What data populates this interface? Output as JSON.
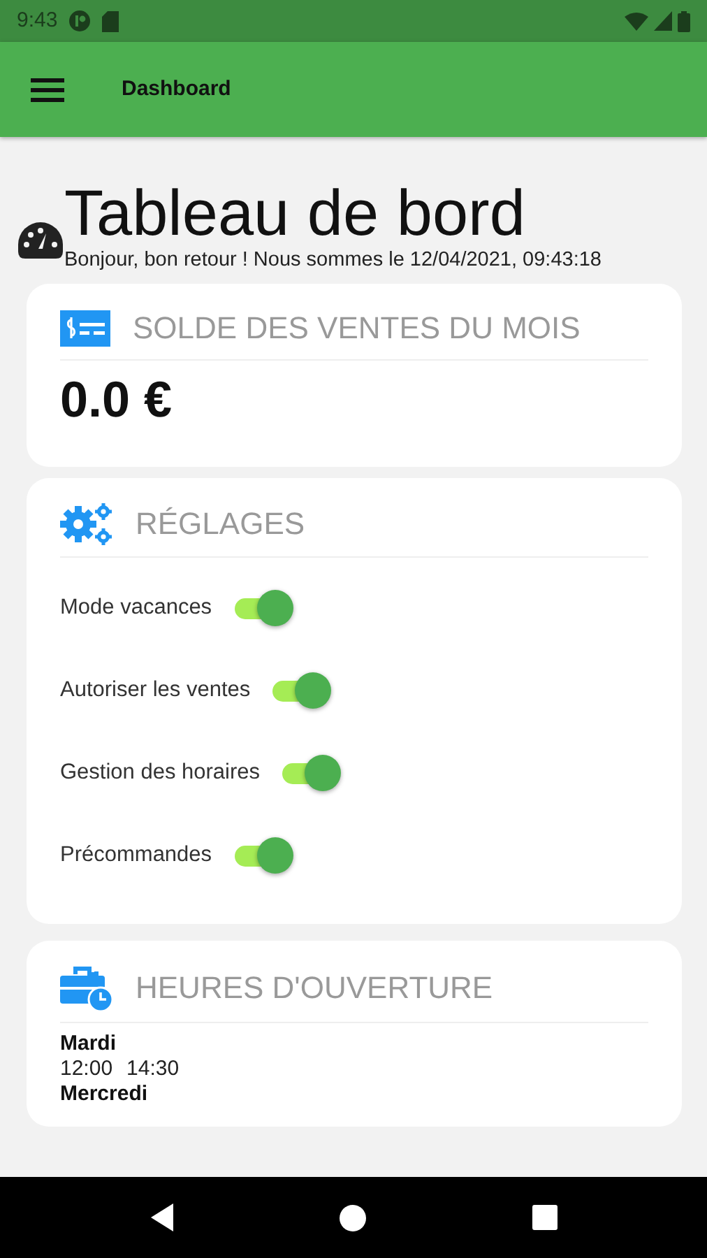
{
  "status_bar": {
    "time": "9:43"
  },
  "app_bar": {
    "title": "Dashboard"
  },
  "header": {
    "title": "Tableau de bord",
    "subtitle": "Bonjour, bon retour ! Nous sommes le 12/04/2021, 09:43:18"
  },
  "sales_card": {
    "title": "SOLDE DES VENTES DU MOIS",
    "amount": "0.0 €"
  },
  "settings_card": {
    "title": "RÉGLAGES",
    "settings": [
      {
        "label": "Mode vacances",
        "on": true
      },
      {
        "label": "Autoriser les ventes",
        "on": true
      },
      {
        "label": "Gestion des horaires",
        "on": true
      },
      {
        "label": "Précommandes",
        "on": true
      }
    ]
  },
  "hours_card": {
    "title": "HEURES D'OUVERTURE",
    "days": [
      {
        "day": "Mardi",
        "times": [
          "12:00",
          "14:30"
        ]
      },
      {
        "day": "Mercredi"
      }
    ]
  }
}
